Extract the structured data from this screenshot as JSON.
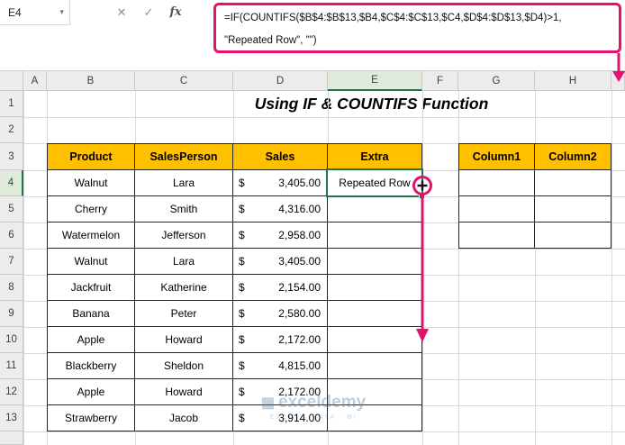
{
  "colors": {
    "annotation": "#e4126d",
    "selection": "#217346",
    "header_fill": "#ffc000"
  },
  "formula_bar": {
    "name_box": "E4",
    "dropdown_icon": "▾",
    "cancel_icon": "✕",
    "enter_icon": "✓",
    "fx_icon": "fx",
    "formula_line1": "=IF(COUNTIFS($B$4:$B$13,$B4,$C$4:$C$13,$C4,$D$4:$D$13,$D4)>1,",
    "formula_line2": "\"Repeated Row\", \"\")"
  },
  "sheet": {
    "title": "Using IF & COUNTIFS Function",
    "column_letters": [
      "A",
      "B",
      "C",
      "D",
      "E",
      "F",
      "G",
      "H"
    ],
    "row_numbers": [
      "1",
      "2",
      "3",
      "4",
      "5",
      "6",
      "7",
      "8",
      "9",
      "10",
      "11",
      "12",
      "13"
    ],
    "selected_cell": "E4",
    "main_table": {
      "headers": [
        "Product",
        "SalesPerson",
        "Sales",
        "Extra"
      ],
      "rows": [
        {
          "product": "Walnut",
          "salesperson": "Lara",
          "currency": "$",
          "amount": "3,405.00",
          "extra": "Repeated Row"
        },
        {
          "product": "Cherry",
          "salesperson": "Smith",
          "currency": "$",
          "amount": "4,316.00",
          "extra": ""
        },
        {
          "product": "Watermelon",
          "salesperson": "Jefferson",
          "currency": "$",
          "amount": "2,958.00",
          "extra": ""
        },
        {
          "product": "Walnut",
          "salesperson": "Lara",
          "currency": "$",
          "amount": "3,405.00",
          "extra": ""
        },
        {
          "product": "Jackfruit",
          "salesperson": "Katherine",
          "currency": "$",
          "amount": "2,154.00",
          "extra": ""
        },
        {
          "product": "Banana",
          "salesperson": "Peter",
          "currency": "$",
          "amount": "2,580.00",
          "extra": ""
        },
        {
          "product": "Apple",
          "salesperson": "Howard",
          "currency": "$",
          "amount": "2,172.00",
          "extra": ""
        },
        {
          "product": "Blackberry",
          "salesperson": "Sheldon",
          "currency": "$",
          "amount": "4,815.00",
          "extra": ""
        },
        {
          "product": "Apple",
          "salesperson": "Howard",
          "currency": "$",
          "amount": "2,172.00",
          "extra": ""
        },
        {
          "product": "Strawberry",
          "salesperson": "Jacob",
          "currency": "$",
          "amount": "3,914.00",
          "extra": ""
        }
      ]
    },
    "side_table": {
      "headers": [
        "Column1",
        "Column2"
      ],
      "empty_rows": 3
    },
    "watermark": {
      "logo": "▦",
      "name": "exceldemy",
      "tagline": "EXCEL · DATA · BI"
    }
  }
}
